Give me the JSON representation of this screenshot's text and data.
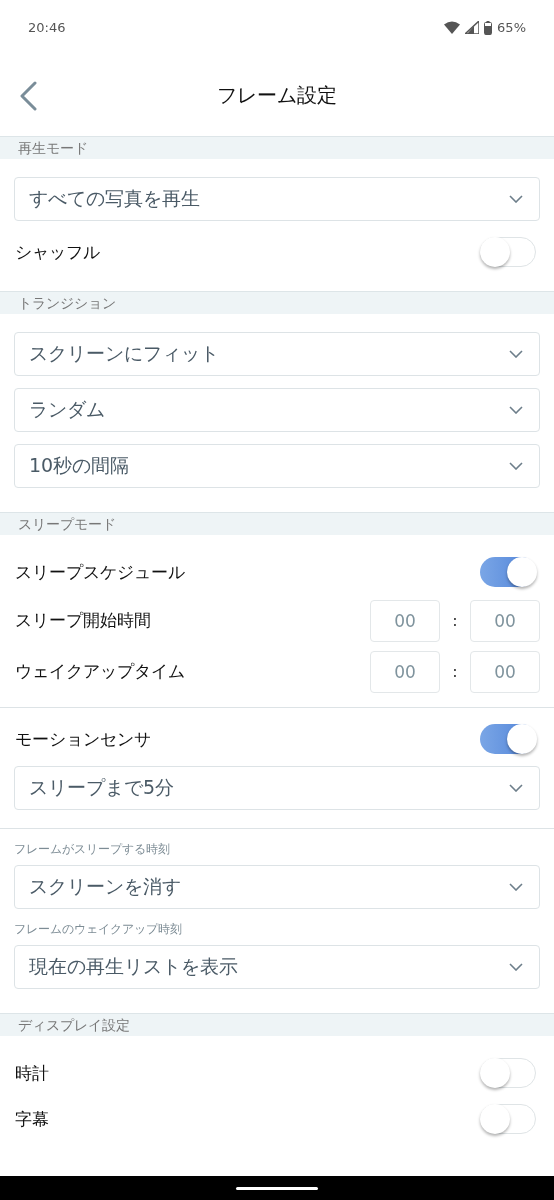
{
  "status_bar": {
    "time": "20:46",
    "battery": "65%"
  },
  "header": {
    "title": "フレーム設定"
  },
  "sections": [
    {
      "header": "再生モード",
      "items": [
        {
          "kind": "dropdown",
          "value": "すべての写真を再生"
        },
        {
          "kind": "toggle",
          "label": "シャッフル",
          "on": false
        }
      ]
    },
    {
      "header": "トランジション",
      "items": [
        {
          "kind": "dropdown",
          "value": "スクリーンにフィット"
        },
        {
          "kind": "dropdown",
          "value": "ランダム"
        },
        {
          "kind": "dropdown",
          "value": "10秒の間隔"
        }
      ]
    },
    {
      "header": "スリープモード",
      "items": [
        {
          "kind": "toggle",
          "label": "スリープスケジュール",
          "on": true
        },
        {
          "kind": "time",
          "label": "スリープ開始時間",
          "hour": "00",
          "separator": ":",
          "minute": "00"
        },
        {
          "kind": "time",
          "label": "ウェイクアップタイム",
          "hour": "00",
          "separator": ":",
          "minute": "00"
        },
        {
          "kind": "divider"
        },
        {
          "kind": "toggle",
          "label": "モーションセンサ",
          "on": true
        },
        {
          "kind": "dropdown",
          "value": "スリープまで5分"
        },
        {
          "kind": "divider"
        },
        {
          "kind": "caption",
          "label": "フレームがスリープする時刻"
        },
        {
          "kind": "dropdown",
          "value": "スクリーンを消す"
        },
        {
          "kind": "caption",
          "label": "フレームのウェイクアップ時刻"
        },
        {
          "kind": "dropdown",
          "value": "現在の再生リストを表示"
        }
      ]
    },
    {
      "header": "ディスプレイ設定",
      "items": [
        {
          "kind": "toggle",
          "label": "時計",
          "on": false
        },
        {
          "kind": "toggle",
          "label": "字幕",
          "on": false
        }
      ]
    }
  ]
}
